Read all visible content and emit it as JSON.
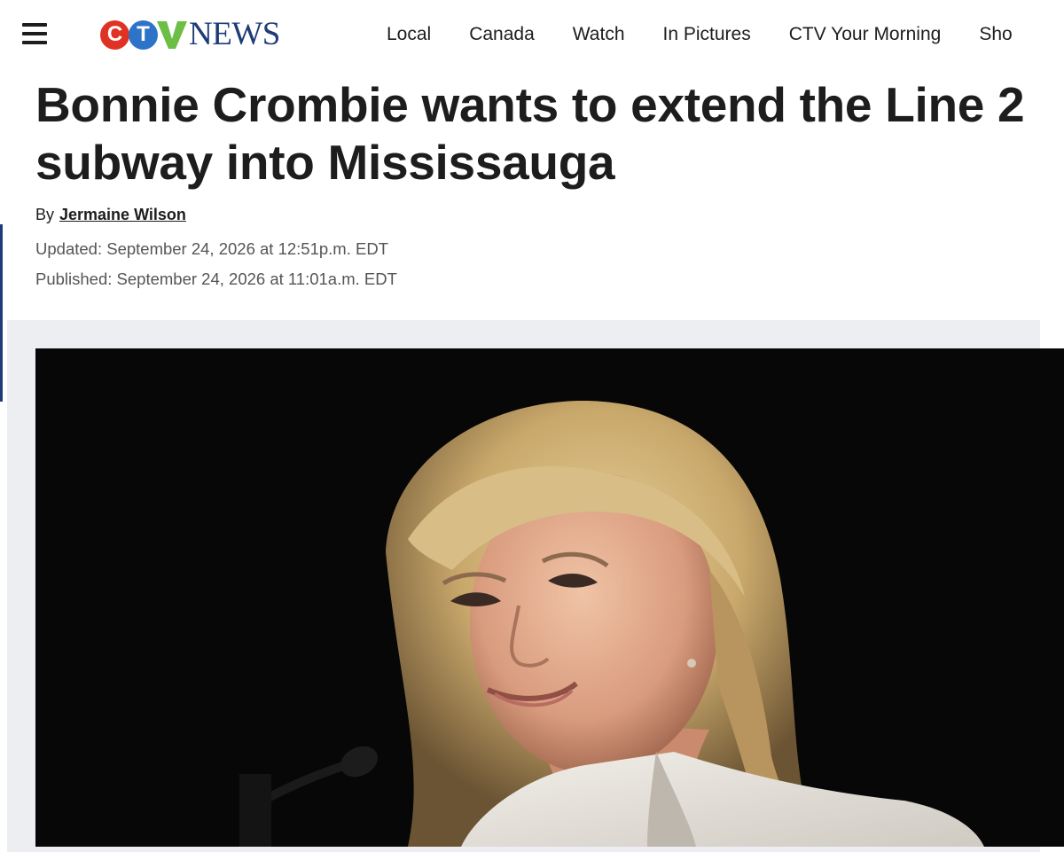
{
  "header": {
    "menu_icon": "hamburger-menu-icon",
    "logo": {
      "letters": [
        "C",
        "T",
        "V"
      ],
      "word": "NEWS",
      "colors": {
        "c": "#e03224",
        "t": "#2d74c8",
        "v": "#6cbe45",
        "news": "#1f3c78"
      }
    },
    "nav": [
      {
        "label": "Local"
      },
      {
        "label": "Canada"
      },
      {
        "label": "Watch"
      },
      {
        "label": "In Pictures"
      },
      {
        "label": "CTV Your Morning"
      },
      {
        "label": "Sho"
      }
    ]
  },
  "article": {
    "headline": "Bonnie Crombie wants to extend the Line 2 subway into Mississauga",
    "byline_prefix": "By",
    "author": "Jermaine Wilson",
    "updated": "Updated: September 24, 2026 at 12:51p.m. EDT",
    "published": "Published: September 24, 2026 at 11:01a.m. EDT",
    "image": {
      "subject": "photo-of-woman-at-microphone"
    }
  },
  "colors": {
    "accent": "#1f3c78",
    "frame_bg": "#edeef2",
    "photo_bg": "#070707"
  }
}
